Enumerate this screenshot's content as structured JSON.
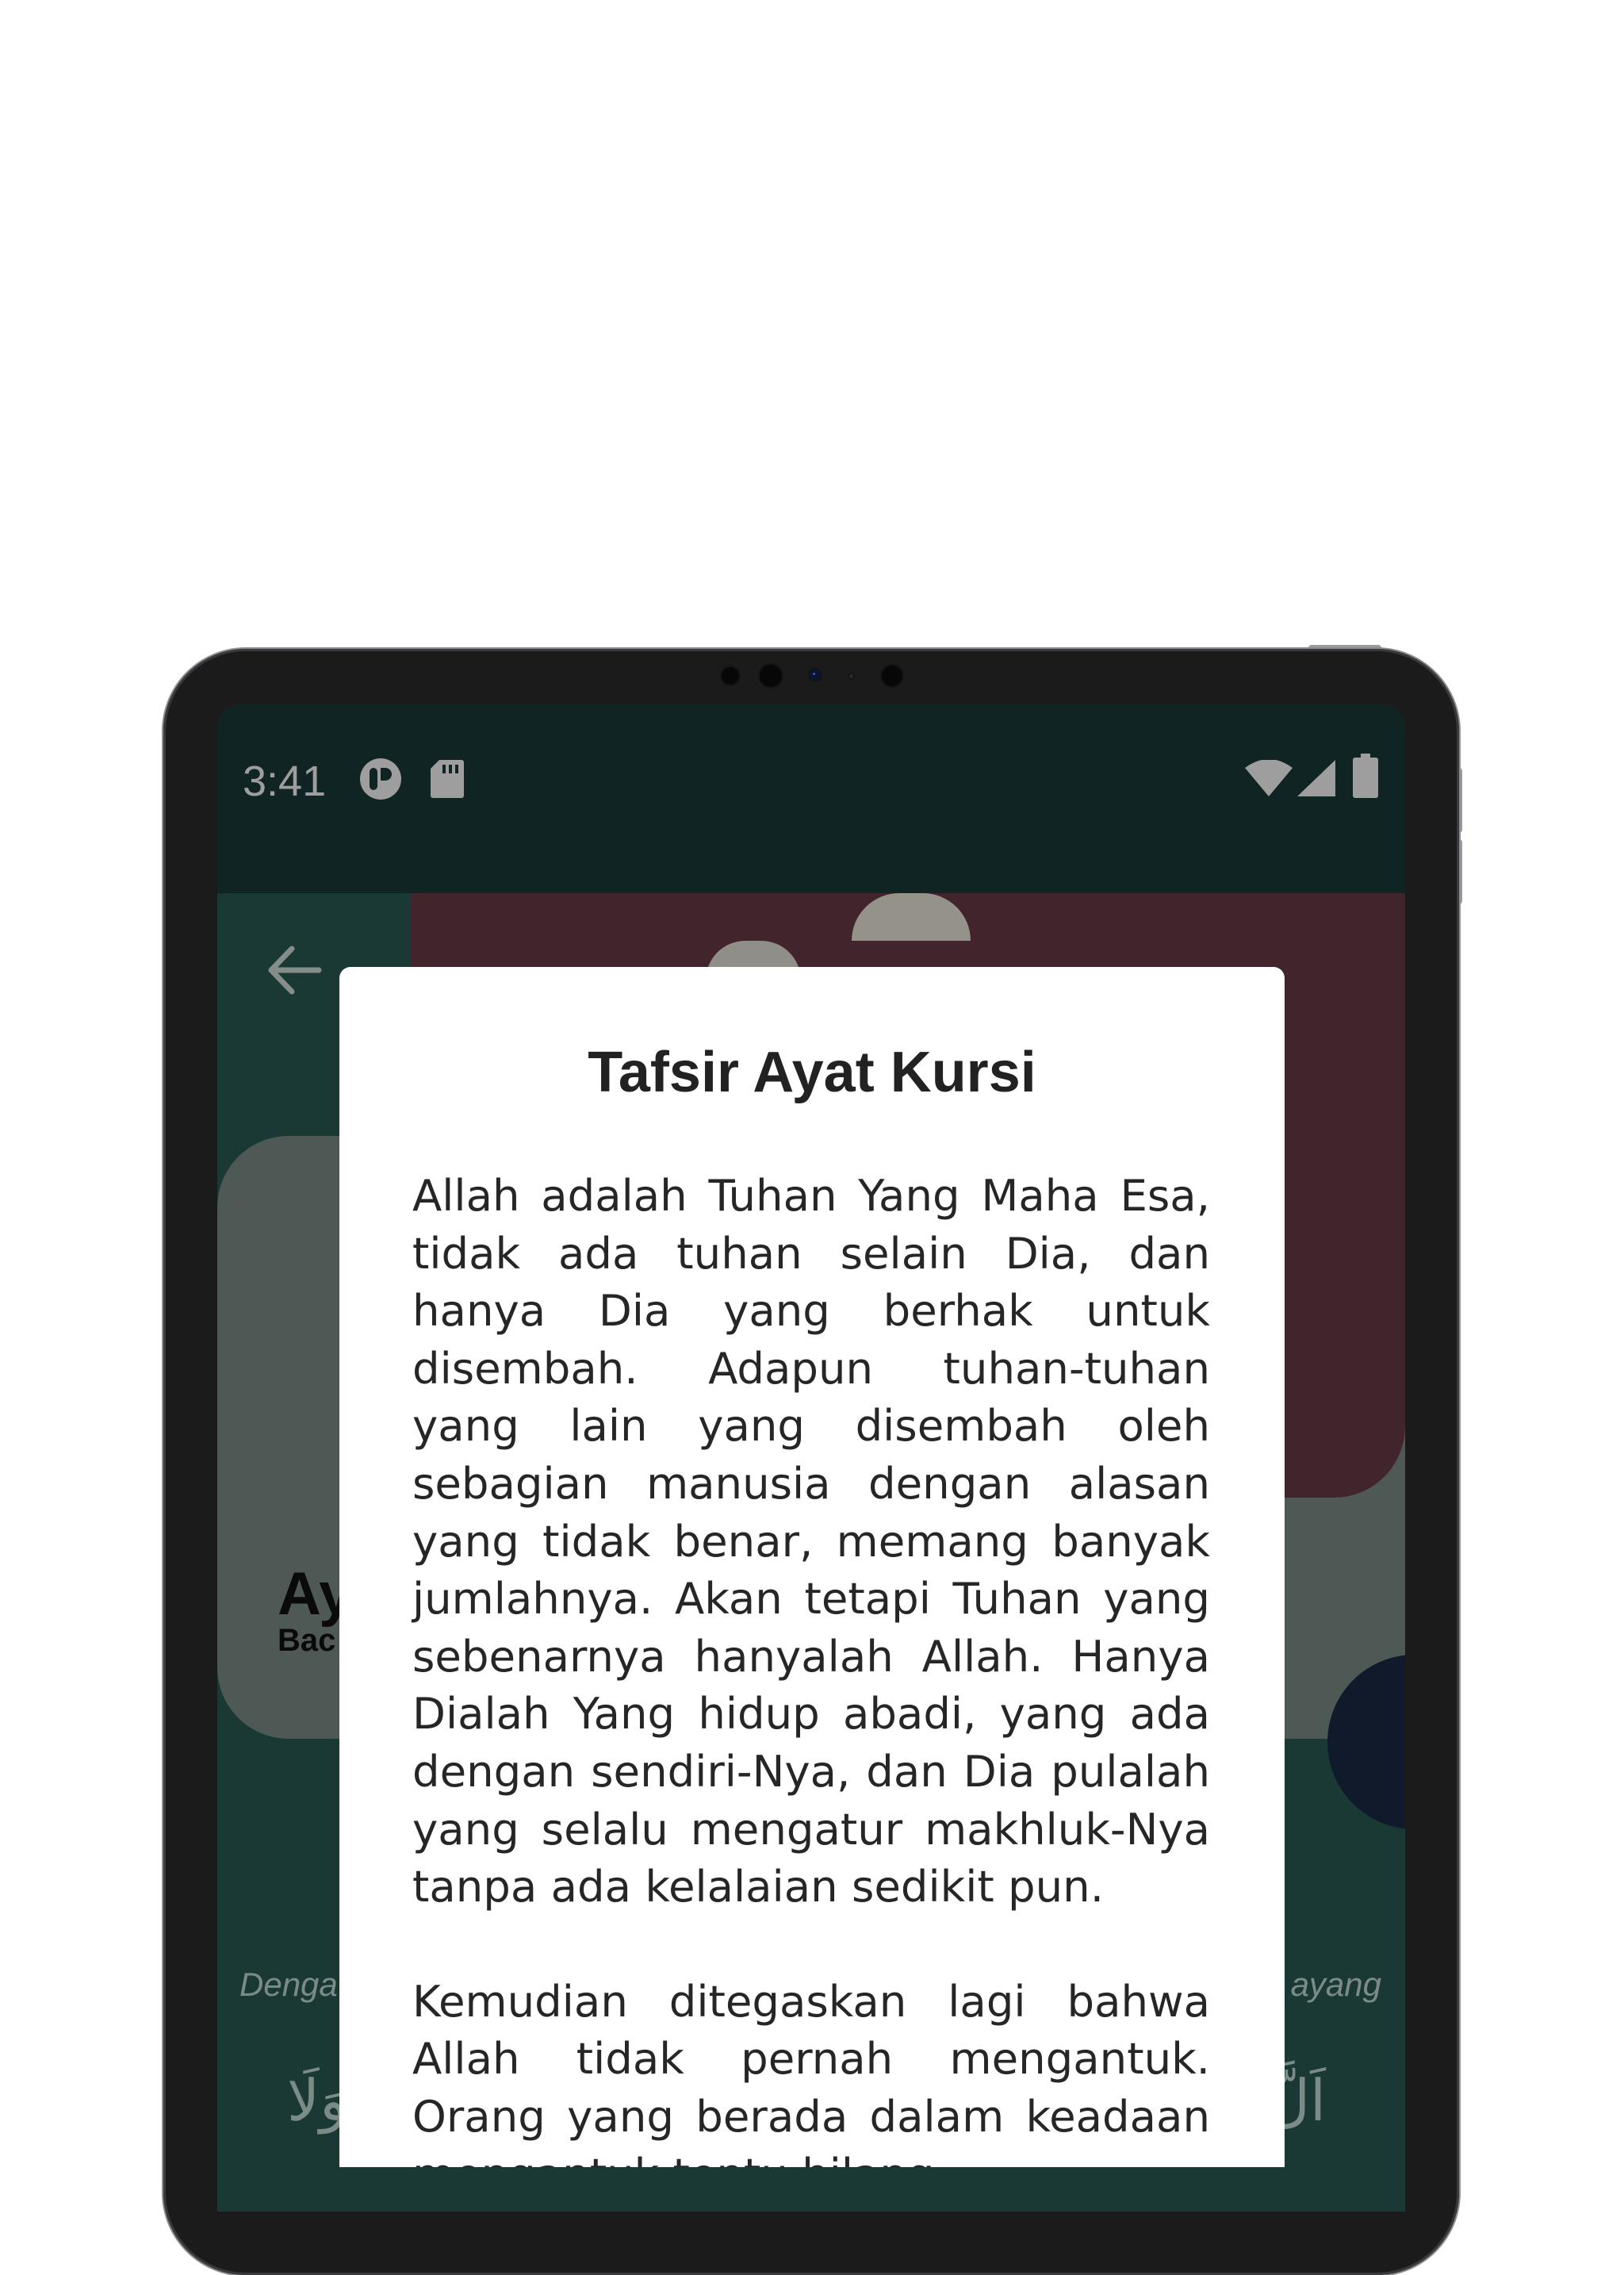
{
  "status_bar": {
    "time": "3:41",
    "left_icons": [
      "app-notification-icon",
      "sd-card-icon"
    ],
    "right_icons": [
      "wifi-icon",
      "cell-signal-icon",
      "battery-icon"
    ]
  },
  "app": {
    "back_icon": "arrow-back-icon",
    "title_partial": "Ay",
    "subtitle_partial": "Bac",
    "bismillah_left_partial": "Denga",
    "bismillah_right_partial": "ayang",
    "arabic_left_partial": "وَلَا",
    "arabic_right_partial": "اَلَّ"
  },
  "dialog": {
    "title": "Tafsir Ayat Kursi",
    "paragraphs": [
      "Allah adalah Tuhan Yang Maha Esa, tidak ada tuhan selain Dia, dan hanya Dia yang berhak untuk disembah. Adapun tuhan-tuhan yang lain yang disembah oleh sebagian manusia dengan alasan yang tidak benar, memang banyak jumlahnya. Akan tetapi Tuhan yang sebenarnya hanyalah Allah. Hanya Dialah Yang hidup abadi, yang ada dengan sendiri-Nya, dan Dia pulalah yang selalu mengatur makhluk-Nya tanpa ada kelalaian sedikit pun.",
      "Kemudian ditegaskan lagi bahwa Allah tidak pernah mengantuk. Orang yang berada dalam keadaan mengantuk tentu hilang"
    ]
  },
  "colors": {
    "status_bar": "#1b3d39",
    "app_background": "#2a5c55",
    "header_card": "#6b3b4a",
    "dialog_background": "#ffffff"
  }
}
